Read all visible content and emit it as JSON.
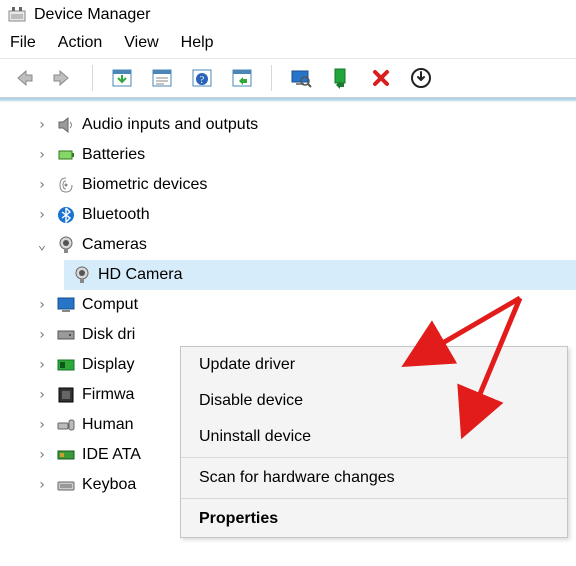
{
  "window": {
    "title": "Device Manager"
  },
  "menu": {
    "file": "File",
    "action": "Action",
    "view": "View",
    "help": "Help"
  },
  "tree": {
    "nodes": [
      {
        "label": "Audio inputs and outputs",
        "expanded": false
      },
      {
        "label": "Batteries",
        "expanded": false
      },
      {
        "label": "Biometric devices",
        "expanded": false
      },
      {
        "label": "Bluetooth",
        "expanded": false
      },
      {
        "label": "Cameras",
        "expanded": true,
        "children": [
          {
            "label": "HD Camera",
            "selected": true
          }
        ]
      },
      {
        "label": "Comput",
        "expanded": false
      },
      {
        "label": "Disk dri",
        "expanded": false
      },
      {
        "label": "Display",
        "expanded": false
      },
      {
        "label": "Firmwa",
        "expanded": false
      },
      {
        "label": "Human",
        "expanded": false
      },
      {
        "label": "IDE ATA",
        "expanded": false
      },
      {
        "label": "Keyboa",
        "expanded": false
      }
    ]
  },
  "context_menu": {
    "update_driver": "Update driver",
    "disable_device": "Disable device",
    "uninstall_device": "Uninstall device",
    "scan_hardware": "Scan for hardware changes",
    "properties": "Properties"
  },
  "toolbar_icons": {
    "back": "back-icon",
    "forward": "forward-icon",
    "show_hide": "show-hide-icon",
    "properties": "properties-icon",
    "help": "help-icon",
    "scan": "scan-icon",
    "monitor": "monitor-icon",
    "install": "install-icon",
    "remove": "remove-icon",
    "update": "update-icon"
  }
}
